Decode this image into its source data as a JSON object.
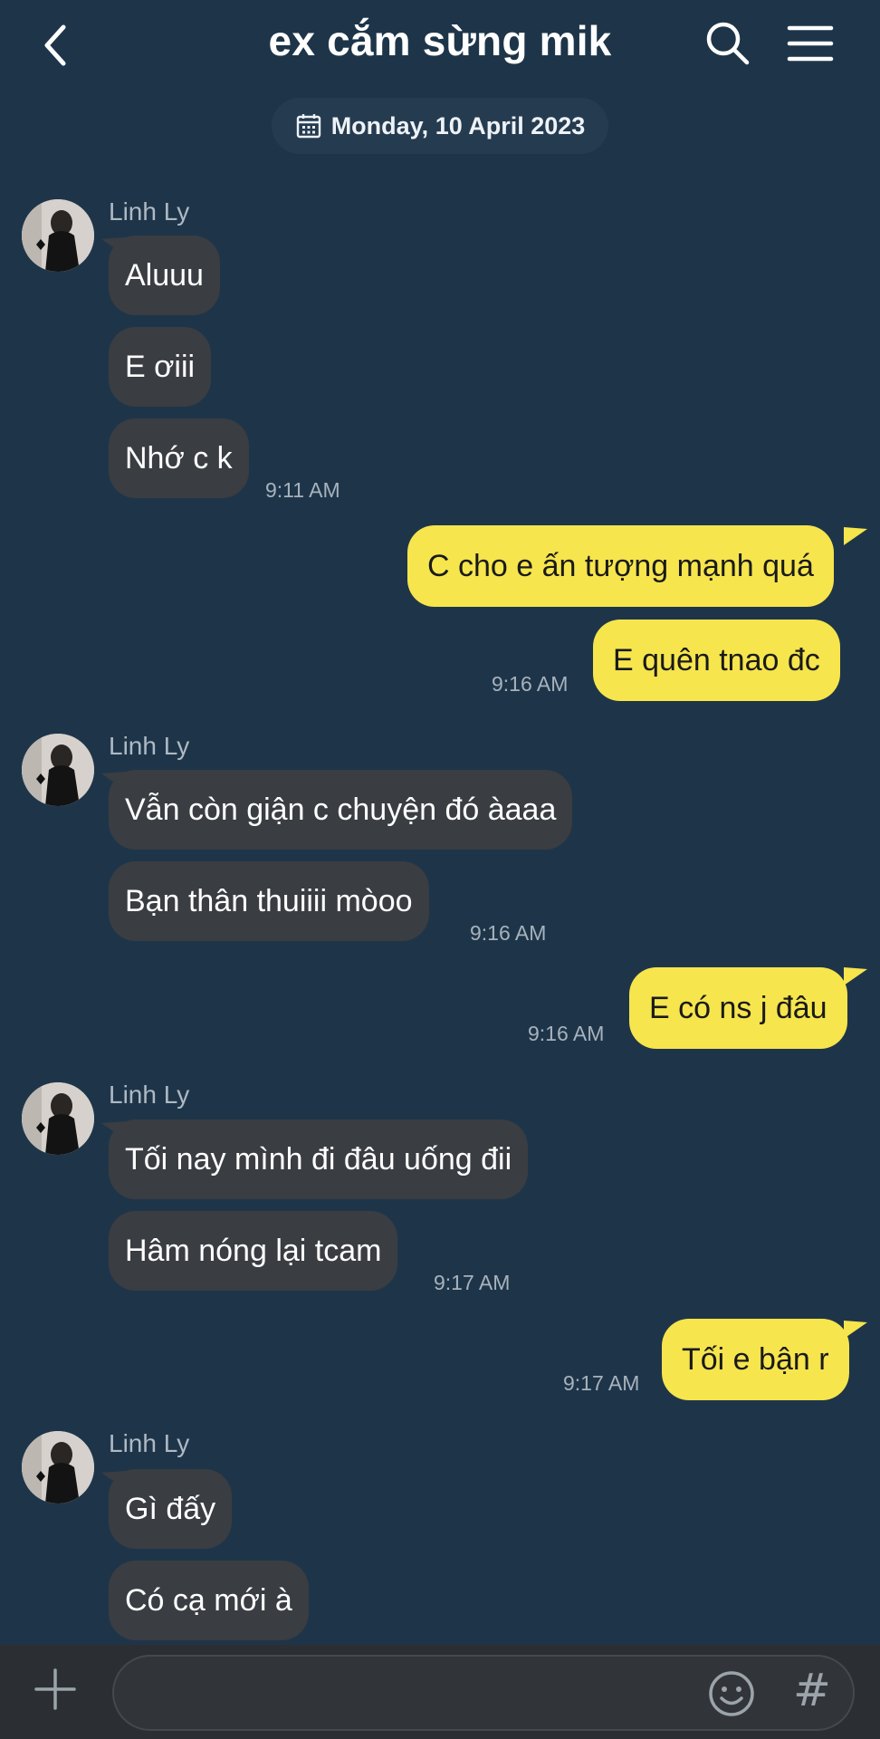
{
  "header": {
    "title": "ex cắm sừng mik",
    "back_icon": "chevron-left-icon",
    "search_icon": "search-icon",
    "menu_icon": "menu-icon"
  },
  "date_divider": {
    "label": "Monday, 10 April 2023",
    "icon": "calendar-icon"
  },
  "messages": [
    {
      "group": "in",
      "sender": "Linh Ly",
      "bubbles": [
        "Aluuu",
        "E ơiii",
        "Nhớ c k"
      ],
      "time": "9:11 AM"
    },
    {
      "group": "out",
      "bubbles": [
        "C cho e ấn tượng mạnh quá",
        "E quên tnao đc"
      ],
      "time": "9:16 AM"
    },
    {
      "group": "in",
      "sender": "Linh Ly",
      "bubbles": [
        "Vẫn còn giận c chuyện đó àaaa",
        "Bạn thân thuiiii mòoo"
      ],
      "time": "9:16 AM"
    },
    {
      "group": "out",
      "bubbles": [
        "E có ns j đâu"
      ],
      "time": "9:16 AM"
    },
    {
      "group": "in",
      "sender": "Linh Ly",
      "bubbles": [
        "Tối nay mình đi đâu uống đii",
        "Hâm nóng lại tcam"
      ],
      "time": "9:17 AM"
    },
    {
      "group": "out",
      "bubbles": [
        "Tối e bận r"
      ],
      "time": "9:17 AM"
    },
    {
      "group": "in",
      "sender": "Linh Ly",
      "bubbles": [
        "Gì đấy",
        "Có cạ mới à"
      ]
    }
  ],
  "composer": {
    "plus_icon": "plus-icon",
    "emoji_icon": "emoji-icon",
    "hash_label": "#"
  },
  "colors": {
    "background": "#1e3549",
    "incoming_bubble": "#3a3d42",
    "outgoing_bubble": "#f6e54d",
    "bottom_bar": "#2b2f33"
  }
}
